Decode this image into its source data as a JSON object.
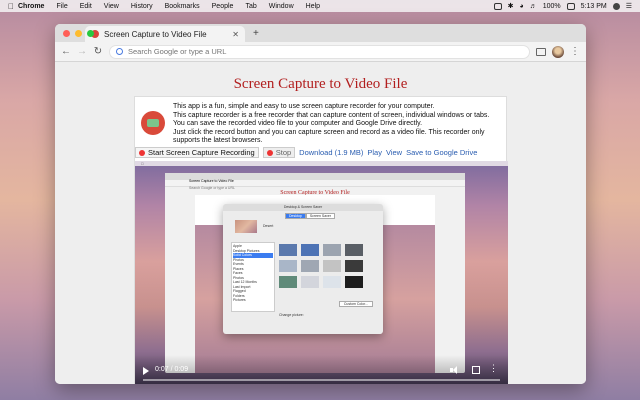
{
  "menubar": {
    "app": "Chrome",
    "items": [
      "File",
      "Edit",
      "View",
      "History",
      "Bookmarks",
      "People",
      "Tab",
      "Window",
      "Help"
    ],
    "battery": "100%",
    "clock": "5:13 PM"
  },
  "browser": {
    "tab_title": "Screen Capture to Video File",
    "omnibox_placeholder": "Search Google or type a URL"
  },
  "page": {
    "title": "Screen Capture to Video File",
    "description": [
      "This app is a fun, simple and easy to use screen capture recorder for your computer.",
      "This capture recorder is a free recorder that can capture content of screen, individual windows or tabs.",
      "You can save the recorded video file to your computer and Google Drive directly.",
      "Just click the record button and you can capture screen and record as a video file. This recorder only",
      "supports the latest browsers."
    ],
    "controls": {
      "record": "Start Screen Capture Recording",
      "stop": "Stop",
      "download": "Download (1.9 MB)",
      "play": "Play",
      "view": "View",
      "save_drive": "Save to Google Drive"
    },
    "video": {
      "time": "0:07 / 0:09",
      "inner_tab": "Screen Capture to Video File",
      "inner_omnibox": "Search Google or type a URL",
      "inner_title": "Screen Capture to Video File",
      "prefs": {
        "title": "Desktop & Screen Saver",
        "tabs": [
          "Desktop",
          "Screen Saver"
        ],
        "preview_label": "Desert",
        "list": [
          "Apple",
          "Desktop Pictures",
          "Solid Colors",
          "Photos",
          "Events",
          "Places",
          "Faces",
          "Photos",
          "Last 12 Months",
          "Last Import",
          "Flagged",
          "Folders",
          "Pictures"
        ],
        "custom_color": "Custom Color...",
        "change_picture": "Change picture:"
      },
      "swatch_colors": [
        "#5b79ad",
        "#4e73b5",
        "#9ca4b0",
        "#5a5f66",
        "#a9b6c8",
        "#9fa7b3",
        "#c3c3c3",
        "#3a3a3a",
        "#5f8a79",
        "#d3d5dc",
        "#dde3ea",
        "#1d1d1d"
      ]
    }
  }
}
